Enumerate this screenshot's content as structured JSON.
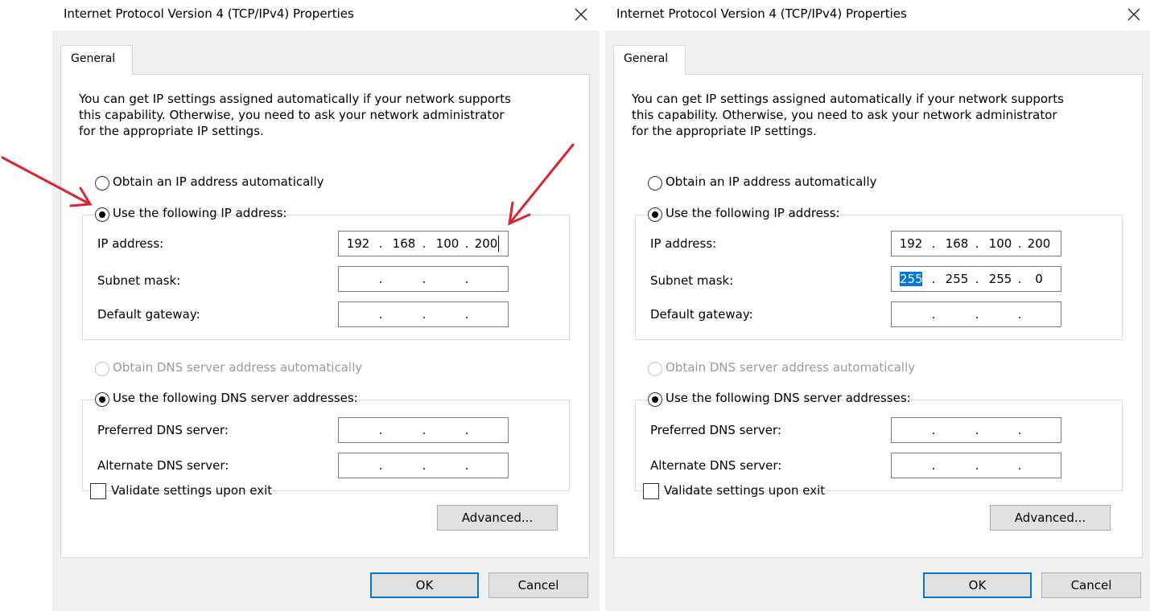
{
  "accent_color": "#0078d7",
  "annotation_color": "#d9262e",
  "dialogs": [
    {
      "title": "Internet Protocol Version 4 (TCP/IPv4) Properties",
      "close_icon": "close-icon",
      "tab": "General",
      "description": [
        "You can get IP settings assigned automatically if your network supports",
        "this capability. Otherwise, you need to ask your network administrator",
        "for the appropriate IP settings."
      ],
      "ip_auto_label": "Obtain an IP address automatically",
      "ip_manual_label": "Use the following IP address:",
      "ip_mode": "manual",
      "ip_address_label": "IP address:",
      "ip_address": [
        "192",
        "168",
        "100",
        "200"
      ],
      "subnet_mask_label": "Subnet mask:",
      "subnet_mask": [
        "",
        "",
        "",
        ""
      ],
      "gateway_label": "Default gateway:",
      "gateway": [
        "",
        "",
        "",
        ""
      ],
      "dns_auto_label": "Obtain DNS server address automatically",
      "dns_manual_label": "Use the following DNS server addresses:",
      "dns_mode": "manual",
      "dns_auto_disabled": true,
      "preferred_dns_label": "Preferred DNS server:",
      "preferred_dns": [
        "",
        "",
        "",
        ""
      ],
      "alternate_dns_label": "Alternate DNS server:",
      "alternate_dns": [
        "",
        "",
        "",
        ""
      ],
      "validate_label": "Validate settings upon exit",
      "validate_checked": false,
      "advanced_label": "Advanced...",
      "ok_label": "OK",
      "cancel_label": "Cancel",
      "focused_field": "ip-address",
      "selected_text": ""
    },
    {
      "title": "Internet Protocol Version 4 (TCP/IPv4) Properties",
      "close_icon": "close-icon",
      "tab": "General",
      "description": [
        "You can get IP settings assigned automatically if your network supports",
        "this capability. Otherwise, you need to ask your network administrator",
        "for the appropriate IP settings."
      ],
      "ip_auto_label": "Obtain an IP address automatically",
      "ip_manual_label": "Use the following IP address:",
      "ip_mode": "manual",
      "ip_address_label": "IP address:",
      "ip_address": [
        "192",
        "168",
        "100",
        "200"
      ],
      "subnet_mask_label": "Subnet mask:",
      "subnet_mask": [
        "255",
        "255",
        "255",
        "0"
      ],
      "gateway_label": "Default gateway:",
      "gateway": [
        "",
        "",
        "",
        ""
      ],
      "dns_auto_label": "Obtain DNS server address automatically",
      "dns_manual_label": "Use the following DNS server addresses:",
      "dns_mode": "manual",
      "dns_auto_disabled": true,
      "preferred_dns_label": "Preferred DNS server:",
      "preferred_dns": [
        "",
        "",
        "",
        ""
      ],
      "alternate_dns_label": "Alternate DNS server:",
      "alternate_dns": [
        "",
        "",
        "",
        ""
      ],
      "validate_label": "Validate settings upon exit",
      "validate_checked": false,
      "advanced_label": "Advanced...",
      "ok_label": "OK",
      "cancel_label": "Cancel",
      "focused_field": "subnet-mask",
      "selected_text": "255"
    }
  ]
}
